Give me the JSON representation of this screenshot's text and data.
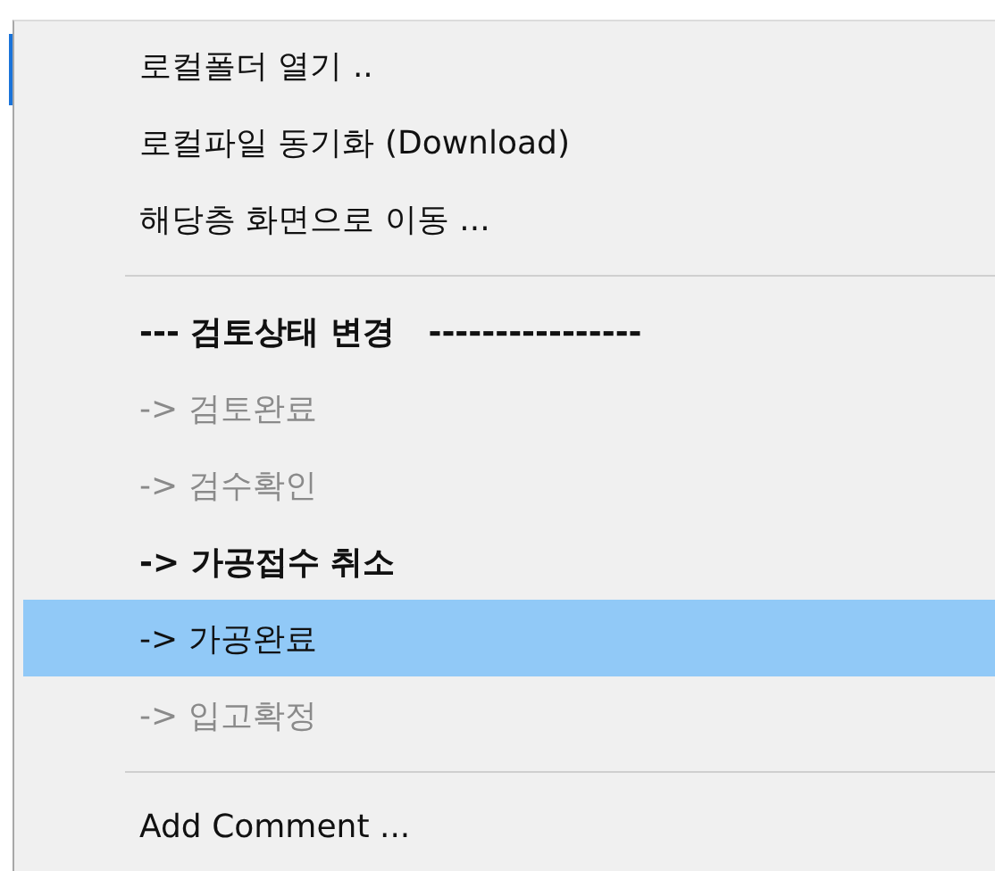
{
  "context_menu": {
    "items": [
      {
        "kind": "item",
        "label": "로컬폴더 열기 ..",
        "disabled": false,
        "selected": false,
        "bold": false
      },
      {
        "kind": "item",
        "label": "로컬파일 동기화 (Download)",
        "disabled": false,
        "selected": false,
        "bold": false
      },
      {
        "kind": "item",
        "label": "해당층 화면으로 이동 ...",
        "disabled": false,
        "selected": false,
        "bold": false
      },
      {
        "kind": "separator"
      },
      {
        "kind": "item",
        "label": "--- 검토상태 변경   ----------------",
        "disabled": false,
        "selected": false,
        "bold": true
      },
      {
        "kind": "item",
        "label": "-> 검토완료",
        "disabled": true,
        "selected": false,
        "bold": false
      },
      {
        "kind": "item",
        "label": "-> 검수확인",
        "disabled": true,
        "selected": false,
        "bold": false
      },
      {
        "kind": "item",
        "label": "-> 가공접수 취소",
        "disabled": false,
        "selected": false,
        "bold": true
      },
      {
        "kind": "item",
        "label": "-> 가공완료",
        "disabled": false,
        "selected": true,
        "bold": false
      },
      {
        "kind": "item",
        "label": "-> 입고확정",
        "disabled": true,
        "selected": false,
        "bold": false
      },
      {
        "kind": "separator"
      },
      {
        "kind": "item",
        "label": "Add Comment ...",
        "disabled": false,
        "selected": false,
        "bold": false
      }
    ]
  }
}
